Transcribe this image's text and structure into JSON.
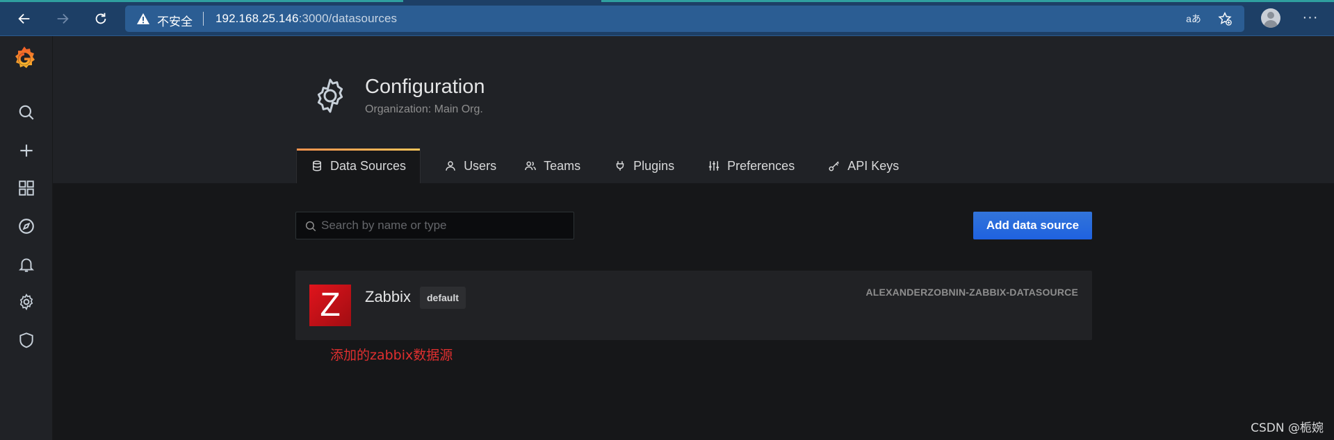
{
  "browser": {
    "insecure_label": "不安全",
    "url_host": "192.168.25.146",
    "url_rest": ":3000/datasources",
    "read_aloud_label": "aあ"
  },
  "sidebar": {
    "items": [
      {
        "icon": "search-icon"
      },
      {
        "icon": "plus-icon"
      },
      {
        "icon": "dashboards-grid-icon"
      },
      {
        "icon": "explore-compass-icon"
      },
      {
        "icon": "alerting-bell-icon"
      },
      {
        "icon": "configuration-gear-icon"
      },
      {
        "icon": "server-admin-shield-icon"
      }
    ]
  },
  "header": {
    "title": "Configuration",
    "subtitle": "Organization: Main Org."
  },
  "tabs": [
    {
      "label": "Data Sources",
      "icon": "database-icon",
      "active": true
    },
    {
      "label": "Users",
      "icon": "user-icon",
      "active": false
    },
    {
      "label": "Teams",
      "icon": "users-icon",
      "active": false
    },
    {
      "label": "Plugins",
      "icon": "plug-icon",
      "active": false
    },
    {
      "label": "Preferences",
      "icon": "sliders-icon",
      "active": false
    },
    {
      "label": "API Keys",
      "icon": "key-icon",
      "active": false
    }
  ],
  "search": {
    "placeholder": "Search by name or type",
    "value": ""
  },
  "actions": {
    "add_label": "Add data source"
  },
  "datasources": [
    {
      "logo_letter": "Z",
      "name": "Zabbix",
      "badge": "default",
      "type": "ALEXANDERZOBNIN-ZABBIX-DATASOURCE"
    }
  ],
  "annotation": "添加的zabbix数据源",
  "watermark": "CSDN @栀婉",
  "colors": {
    "accent_blue": "#3274d9",
    "tab_gradient_start": "#f9934e",
    "tab_gradient_end": "#fbc55a",
    "annotation_red": "#e02f2f",
    "zabbix_red": "#d40000"
  }
}
